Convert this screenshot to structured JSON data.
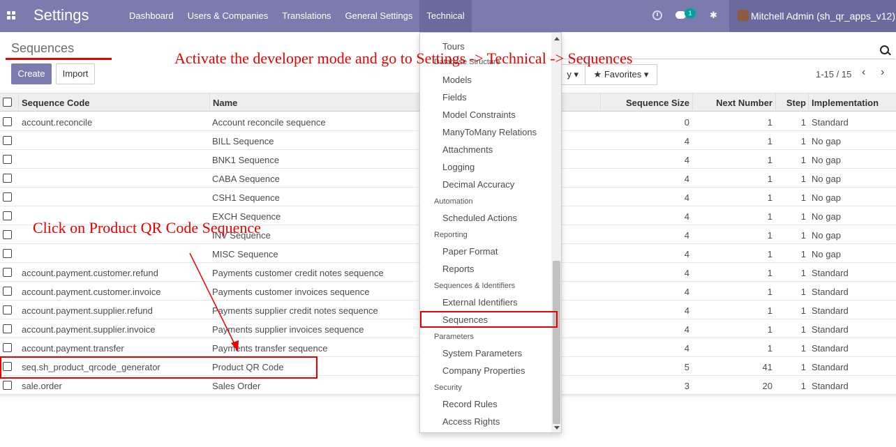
{
  "navbar": {
    "brand": "Settings",
    "menu": [
      "Dashboard",
      "Users & Companies",
      "Translations",
      "General Settings",
      "Technical"
    ],
    "chat_count": "1",
    "user": "Mitchell Admin (sh_qr_apps_v12)",
    "bar_color": "#7c7bad"
  },
  "control": {
    "breadcrumb": "Sequences",
    "create_label": "Create",
    "import_label": "Import",
    "groupby_label": "y",
    "favorites_label": "Favorites",
    "pager": "1-15 / 15"
  },
  "table": {
    "headers": [
      "Sequence Code",
      "Name",
      "Sequence Size",
      "Next Number",
      "Step",
      "Implementation"
    ],
    "rows": [
      {
        "code": "account.reconcile",
        "name": "Account reconcile sequence",
        "size": "0",
        "next": "1",
        "step": "1",
        "impl": "Standard"
      },
      {
        "code": "",
        "name": "BILL Sequence",
        "size": "4",
        "next": "1",
        "step": "1",
        "impl": "No gap"
      },
      {
        "code": "",
        "name": "BNK1 Sequence",
        "size": "4",
        "next": "1",
        "step": "1",
        "impl": "No gap"
      },
      {
        "code": "",
        "name": "CABA Sequence",
        "size": "4",
        "next": "1",
        "step": "1",
        "impl": "No gap"
      },
      {
        "code": "",
        "name": "CSH1 Sequence",
        "size": "4",
        "next": "1",
        "step": "1",
        "impl": "No gap"
      },
      {
        "code": "",
        "name": "EXCH Sequence",
        "size": "4",
        "next": "1",
        "step": "1",
        "impl": "No gap"
      },
      {
        "code": "",
        "name": "INV Sequence",
        "size": "4",
        "next": "1",
        "step": "1",
        "impl": "No gap"
      },
      {
        "code": "",
        "name": "MISC Sequence",
        "size": "4",
        "next": "1",
        "step": "1",
        "impl": "No gap"
      },
      {
        "code": "account.payment.customer.refund",
        "name": "Payments customer credit notes sequence",
        "size": "4",
        "next": "1",
        "step": "1",
        "impl": "Standard"
      },
      {
        "code": "account.payment.customer.invoice",
        "name": "Payments customer invoices sequence",
        "size": "4",
        "next": "1",
        "step": "1",
        "impl": "Standard"
      },
      {
        "code": "account.payment.supplier.refund",
        "name": "Payments supplier credit notes sequence",
        "size": "4",
        "next": "1",
        "step": "1",
        "impl": "Standard"
      },
      {
        "code": "account.payment.supplier.invoice",
        "name": "Payments supplier invoices sequence",
        "size": "4",
        "next": "1",
        "step": "1",
        "impl": "Standard"
      },
      {
        "code": "account.payment.transfer",
        "name": "Payments transfer sequence",
        "size": "4",
        "next": "1",
        "step": "1",
        "impl": "Standard"
      },
      {
        "code": "seq.sh_product_qrcode_generator",
        "name": "Product QR Code",
        "size": "5",
        "next": "41",
        "step": "1",
        "impl": "Standard"
      },
      {
        "code": "sale.order",
        "name": "Sales Order",
        "size": "3",
        "next": "20",
        "step": "1",
        "impl": "Standard"
      }
    ]
  },
  "dropdown": {
    "partial_header": "Database Structure",
    "items": [
      {
        "type": "item",
        "label": "Tours"
      },
      {
        "type": "item",
        "label": "Models"
      },
      {
        "type": "item",
        "label": "Fields"
      },
      {
        "type": "item",
        "label": "Model Constraints"
      },
      {
        "type": "item",
        "label": "ManyToMany Relations"
      },
      {
        "type": "item",
        "label": "Attachments"
      },
      {
        "type": "item",
        "label": "Logging"
      },
      {
        "type": "item",
        "label": "Decimal Accuracy"
      },
      {
        "type": "header",
        "label": "Automation"
      },
      {
        "type": "item",
        "label": "Scheduled Actions"
      },
      {
        "type": "header",
        "label": "Reporting"
      },
      {
        "type": "item",
        "label": "Paper Format"
      },
      {
        "type": "item",
        "label": "Reports"
      },
      {
        "type": "header",
        "label": "Sequences & Identifiers"
      },
      {
        "type": "item",
        "label": "External Identifiers"
      },
      {
        "type": "item",
        "label": "Sequences"
      },
      {
        "type": "header",
        "label": "Parameters"
      },
      {
        "type": "item",
        "label": "System Parameters"
      },
      {
        "type": "item",
        "label": "Company Properties"
      },
      {
        "type": "header",
        "label": "Security"
      },
      {
        "type": "item",
        "label": "Record Rules"
      },
      {
        "type": "item",
        "label": "Access Rights"
      }
    ]
  },
  "annotations": {
    "top": "Activate the developer mode and go to Settings -> Technical -> Sequences",
    "left": "Click on Product QR Code Sequence",
    "color": "#e60000"
  }
}
